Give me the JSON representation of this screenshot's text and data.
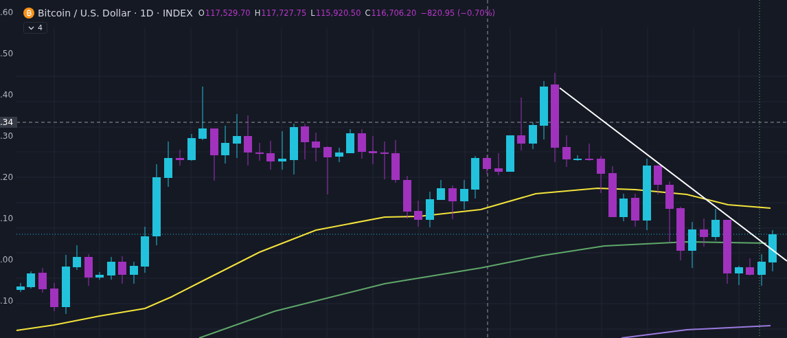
{
  "legend": {
    "title": "Bitcoin / U.S. Dollar · 1D · INDEX",
    "ohlc": [
      {
        "label": "O",
        "value": "117,529.70"
      },
      {
        "label": "H",
        "value": "117,727.75"
      },
      {
        "label": "L",
        "value": "115,920.50"
      },
      {
        "label": "C",
        "value": "116,706.20"
      }
    ],
    "change": "−820.95 (−0.70%)",
    "indicator_toggle": {
      "count": "4"
    }
  },
  "price_axis": {
    "labels": [
      ".60",
      ".50",
      ".40",
      ".30",
      ".20",
      ".10",
      ".00",
      ".10"
    ],
    "crosshair_label": ".34"
  }
}
